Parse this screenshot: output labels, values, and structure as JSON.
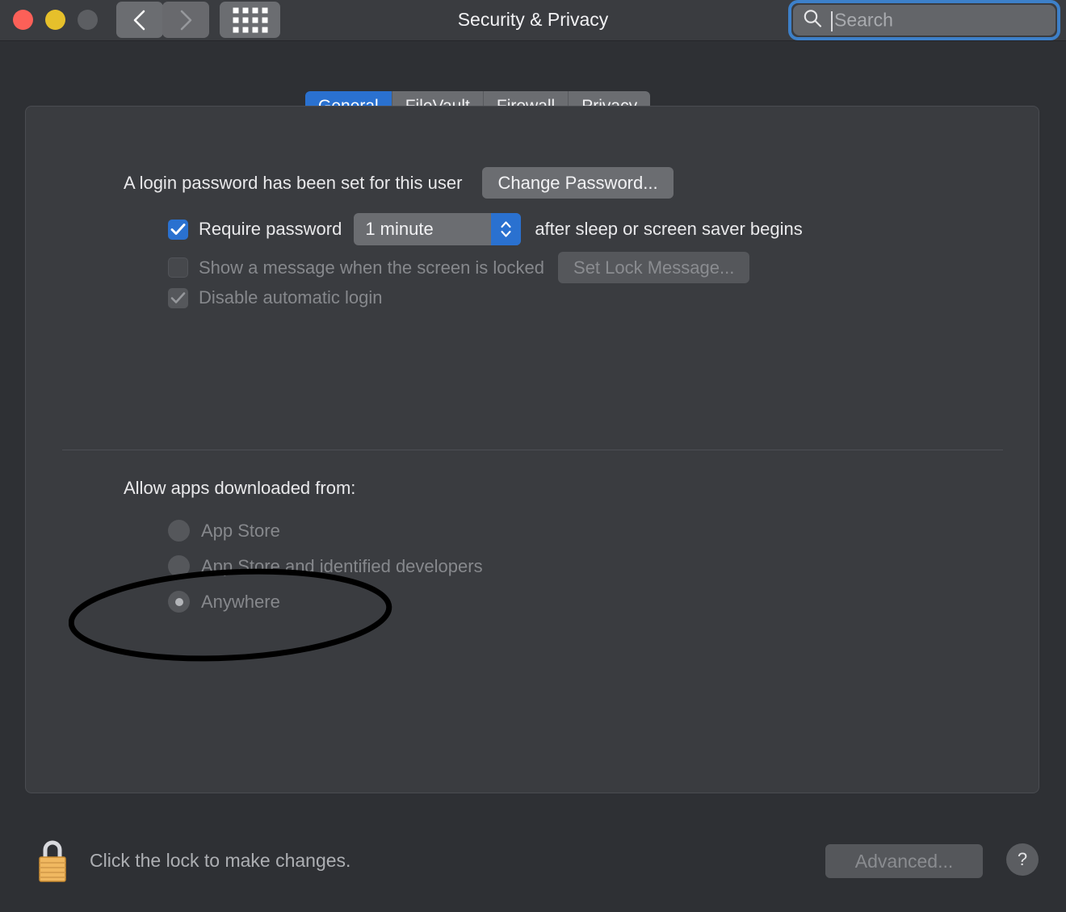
{
  "window": {
    "title": "Security & Privacy",
    "traffic_lights": [
      "close",
      "minimize",
      "zoom"
    ],
    "nav_back_icon": "chevron-left-icon",
    "nav_forward_icon": "chevron-right-icon",
    "grid_icon": "all-preferences-grid-icon"
  },
  "search": {
    "placeholder": "Search",
    "value": "",
    "icon": "search-icon",
    "focused": true,
    "focus_ring_color": "#3d80c9"
  },
  "tabs": [
    {
      "label": "General",
      "active": true
    },
    {
      "label": "FileVault",
      "active": false
    },
    {
      "label": "Firewall",
      "active": false
    },
    {
      "label": "Privacy",
      "active": false
    }
  ],
  "general": {
    "password_status": "A login password has been set for this user",
    "change_password_label": "Change Password...",
    "require_password": {
      "label": "Require password",
      "checked": true,
      "interval": "1 minute",
      "suffix": "after sleep or screen saver begins"
    },
    "show_message": {
      "label": "Show a message when the screen is locked",
      "checked": false,
      "disabled": true,
      "button_label": "Set Lock Message..."
    },
    "disable_auto_login": {
      "label": "Disable automatic login",
      "checked": true,
      "disabled": true
    },
    "allow_apps_title": "Allow apps downloaded from:",
    "allow_apps_options": [
      {
        "label": "App Store",
        "selected": false
      },
      {
        "label": "App Store and identified developers",
        "selected": false
      },
      {
        "label": "Anywhere",
        "selected": true
      }
    ]
  },
  "footer": {
    "lock_icon": "padlock-closed-icon",
    "lock_text": "Click the lock to make changes.",
    "advanced_label": "Advanced...",
    "help_label": "?"
  },
  "annotation": {
    "shape": "ellipse",
    "color": "#000000",
    "target": "Anywhere"
  },
  "colors": {
    "accent_blue": "#2a71d0",
    "window_bg": "#2e3034",
    "panel_bg": "#3a3c40",
    "control_gray": "#6b6d71",
    "disabled_text": "#86888c"
  }
}
